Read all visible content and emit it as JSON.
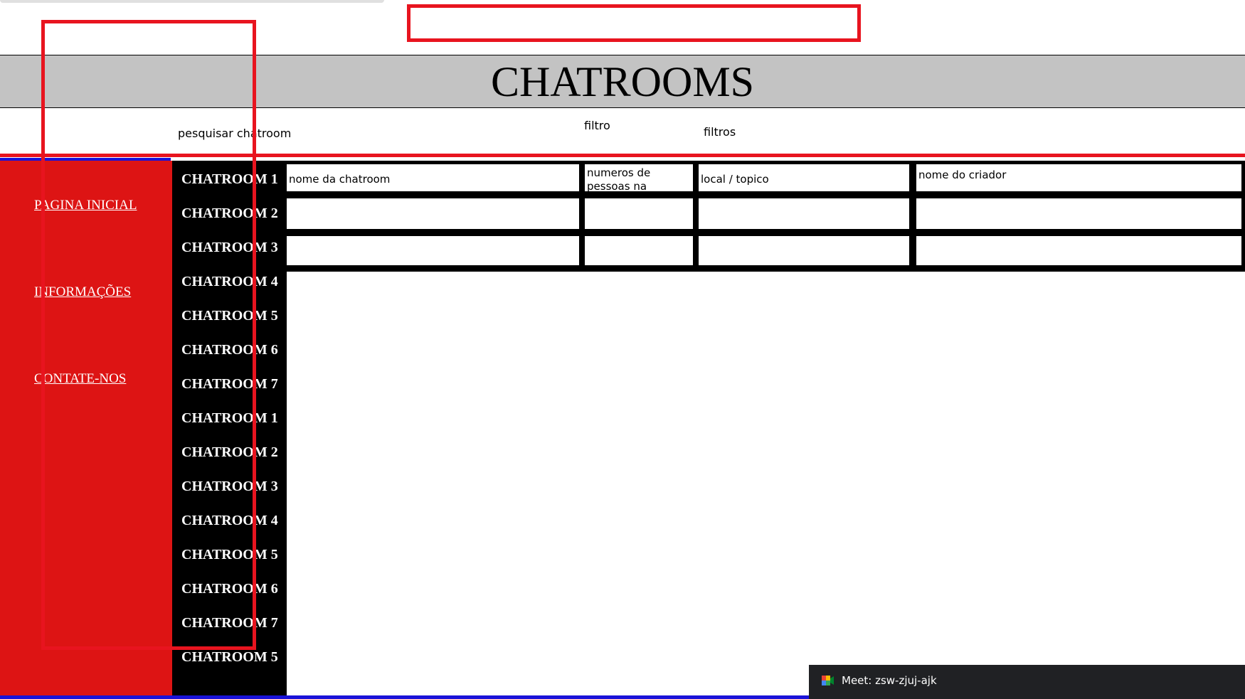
{
  "header": {
    "title": "CHATROOMS",
    "search_label": "pesquisar chatroom",
    "filtro_label": "filtro",
    "filtros_label": "filtros"
  },
  "sidebar": {
    "items": [
      {
        "label": "PAGINA INICIAL"
      },
      {
        "label": "INFORMAÇÕES"
      },
      {
        "label": "CONTATE-NOS"
      }
    ]
  },
  "rooms": [
    "CHATROOM 1",
    "CHATROOM 2",
    "CHATROOM 3",
    "CHATROOM 4",
    "CHATROOM 5",
    "CHATROOM 6",
    "CHATROOM 7",
    "CHATROOM 1",
    "CHATROOM 2",
    "CHATROOM 3",
    "CHATROOM 4",
    "CHATROOM 5",
    "CHATROOM 6",
    "CHATROOM 7",
    "CHATROOM 5"
  ],
  "table": {
    "headers": [
      "nome da chatroom",
      "numeros de pessoas na chatroom",
      "local / topico",
      "nome do criador"
    ]
  },
  "notification": {
    "text": "Meet: zsw-zjuj-ajk",
    "icon": "google-meet-icon"
  },
  "colors": {
    "sidebar": "#dd1414",
    "room_column": "#000000",
    "header_band": "#c3c3c3",
    "accent_line": "#e8141f",
    "blue_line": "#1a12d8",
    "annotation": "#e8141f"
  }
}
